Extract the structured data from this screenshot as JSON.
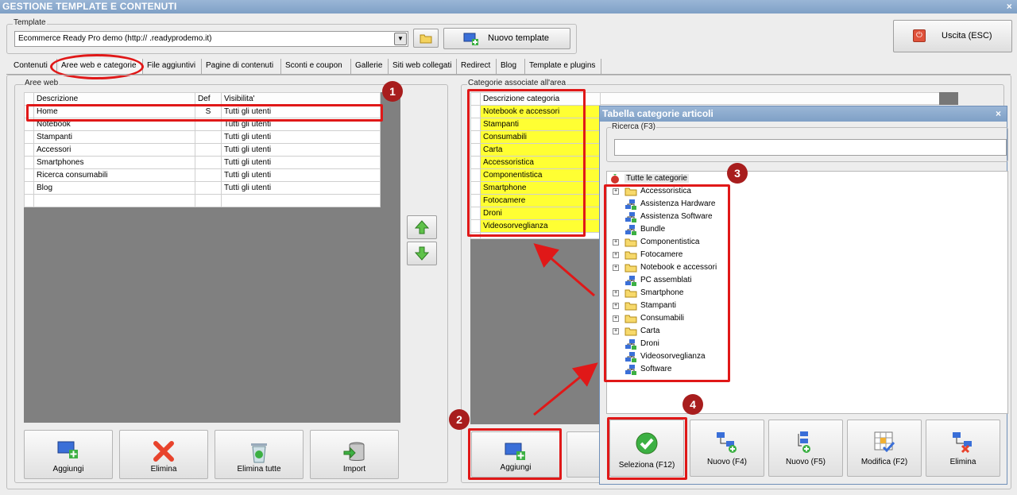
{
  "window": {
    "title": "GESTIONE TEMPLATE E CONTENUTI",
    "close": "×"
  },
  "template": {
    "group_label": "Template",
    "selected": "Ecommerce Ready Pro demo      (http://        .readyprodemo.it)",
    "new_button": "Nuovo template",
    "exit_button": "Uscita (ESC)"
  },
  "tabs": [
    {
      "label": "Contenuti"
    },
    {
      "label": "Aree web e categorie"
    },
    {
      "label": "File aggiuntivi"
    },
    {
      "label": "Pagine di contenuti"
    },
    {
      "label": "Sconti e coupon"
    },
    {
      "label": "Gallerie"
    },
    {
      "label": "Siti web collegati"
    },
    {
      "label": "Redirect"
    },
    {
      "label": "Blog"
    },
    {
      "label": "Template e plugins"
    }
  ],
  "aree_web": {
    "label": "Aree web",
    "headers": [
      "Descrizione",
      "Def",
      "Visibilita'"
    ],
    "rows": [
      [
        "Home",
        "S",
        "Tutti gli utenti"
      ],
      [
        "Notebook",
        "",
        "Tutti gli utenti"
      ],
      [
        "Stampanti",
        "",
        "Tutti gli utenti"
      ],
      [
        "Accessori",
        "",
        "Tutti gli utenti"
      ],
      [
        "Smartphones",
        "",
        "Tutti gli utenti"
      ],
      [
        "Ricerca consumabili",
        "",
        "Tutti gli utenti"
      ],
      [
        "Blog",
        "",
        "Tutti gli utenti"
      ]
    ],
    "buttons": {
      "aggiungi": "Aggiungi",
      "elimina": "Elimina",
      "elimina_tutte": "Elimina tutte",
      "import": "Import"
    }
  },
  "categorie_area": {
    "label": "Categorie associate all'area",
    "header": "Descrizione categoria",
    "rows": [
      "Notebook e accessori",
      "Stampanti",
      "Consumabili",
      "Carta",
      "Accessoristica",
      "Componentistica",
      "Smartphone",
      "Fotocamere",
      "Droni",
      "Videosorveglianza"
    ],
    "aggiungi": "Aggiungi"
  },
  "dialog": {
    "title": "Tabella categorie articoli",
    "close": "×",
    "search_label": "Ricerca (F3)",
    "search_value": "",
    "root": "Tutte le categorie",
    "items": [
      {
        "label": "Accessoristica",
        "kind": "folder",
        "expandable": true
      },
      {
        "label": "Assistenza Hardware",
        "kind": "item",
        "expandable": false
      },
      {
        "label": "Assistenza Software",
        "kind": "item",
        "expandable": false
      },
      {
        "label": "Bundle",
        "kind": "item",
        "expandable": false
      },
      {
        "label": "Componentistica",
        "kind": "folder",
        "expandable": true
      },
      {
        "label": "Fotocamere",
        "kind": "folder",
        "expandable": true
      },
      {
        "label": "Notebook e accessori",
        "kind": "folder",
        "expandable": true
      },
      {
        "label": "PC assemblati",
        "kind": "item",
        "expandable": false
      },
      {
        "label": "Smartphone",
        "kind": "folder",
        "expandable": true
      },
      {
        "label": "Stampanti",
        "kind": "folder",
        "expandable": true
      },
      {
        "label": "Consumabili",
        "kind": "folder",
        "expandable": true
      },
      {
        "label": "Carta",
        "kind": "folder",
        "expandable": true
      },
      {
        "label": "Droni",
        "kind": "item",
        "expandable": false
      },
      {
        "label": "Videosorveglianza",
        "kind": "item",
        "expandable": false
      },
      {
        "label": "Software",
        "kind": "item",
        "expandable": false
      }
    ],
    "buttons": {
      "seleziona": "Seleziona (F12)",
      "nuovo_f4": "Nuovo (F4)",
      "nuovo_f5": "Nuovo (F5)",
      "modifica": "Modifica (F2)",
      "elimina": "Elimina"
    }
  },
  "markers": [
    "1",
    "2",
    "3",
    "4"
  ],
  "colors": {
    "highlight": "#ffff33",
    "annotation": "#e01818",
    "marker": "#a81d1d"
  }
}
